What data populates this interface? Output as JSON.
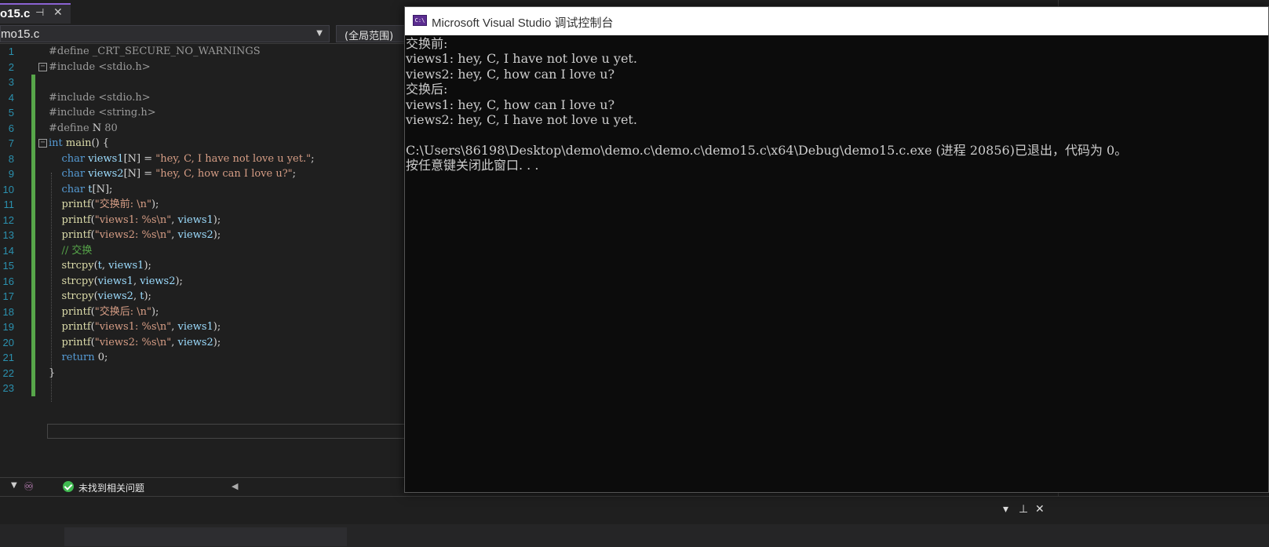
{
  "editor": {
    "tab": {
      "title": "o15.c",
      "pin_icon": "pin-icon",
      "close_icon": "close-icon"
    },
    "navbar": {
      "file": "mo15.c",
      "scope": "(全局范围)"
    },
    "lines": [
      {
        "num": "1",
        "segments": [
          {
            "t": "#define _CRT_SECURE_NO_WARNINGS",
            "c": "pp"
          }
        ]
      },
      {
        "num": "2",
        "segments": [
          {
            "t": "#include <stdio.h>",
            "c": "pp"
          }
        ]
      },
      {
        "num": "3",
        "segments": []
      },
      {
        "num": "4",
        "segments": [
          {
            "t": "#include <stdio.h>",
            "c": "pp"
          }
        ]
      },
      {
        "num": "5",
        "segments": [
          {
            "t": "#include <string.h>",
            "c": "pp"
          }
        ]
      },
      {
        "num": "6",
        "segments": [
          {
            "t": "#define ",
            "c": "pp"
          },
          {
            "t": "N",
            "c": "plain"
          },
          {
            "t": " 80",
            "c": "pp"
          }
        ]
      },
      {
        "num": "7",
        "segments": [
          {
            "t": "int",
            "c": "kw"
          },
          {
            "t": " ",
            "c": "plain"
          },
          {
            "t": "main",
            "c": "fn"
          },
          {
            "t": "() {",
            "c": "plain"
          }
        ]
      },
      {
        "num": "8",
        "segments": [
          {
            "t": "    ",
            "c": "plain"
          },
          {
            "t": "char",
            "c": "kw"
          },
          {
            "t": " ",
            "c": "plain"
          },
          {
            "t": "views1",
            "c": "id"
          },
          {
            "t": "[N] = ",
            "c": "plain"
          },
          {
            "t": "\"hey, C, I have not love u yet.\"",
            "c": "str"
          },
          {
            "t": ";",
            "c": "plain"
          }
        ]
      },
      {
        "num": "9",
        "segments": [
          {
            "t": "    ",
            "c": "plain"
          },
          {
            "t": "char",
            "c": "kw"
          },
          {
            "t": " ",
            "c": "plain"
          },
          {
            "t": "views2",
            "c": "id"
          },
          {
            "t": "[N] = ",
            "c": "plain"
          },
          {
            "t": "\"hey, C, how can I love u?\"",
            "c": "str"
          },
          {
            "t": ";",
            "c": "plain"
          }
        ]
      },
      {
        "num": "10",
        "segments": [
          {
            "t": "    ",
            "c": "plain"
          },
          {
            "t": "char",
            "c": "kw"
          },
          {
            "t": " ",
            "c": "plain"
          },
          {
            "t": "t",
            "c": "id"
          },
          {
            "t": "[N];",
            "c": "plain"
          }
        ]
      },
      {
        "num": "11",
        "segments": [
          {
            "t": "    ",
            "c": "plain"
          },
          {
            "t": "printf",
            "c": "fn"
          },
          {
            "t": "(",
            "c": "plain"
          },
          {
            "t": "\"交换前: \\n\"",
            "c": "str"
          },
          {
            "t": ");",
            "c": "plain"
          }
        ]
      },
      {
        "num": "12",
        "segments": [
          {
            "t": "    ",
            "c": "plain"
          },
          {
            "t": "printf",
            "c": "fn"
          },
          {
            "t": "(",
            "c": "plain"
          },
          {
            "t": "\"views1: %s\\n\"",
            "c": "str"
          },
          {
            "t": ", ",
            "c": "plain"
          },
          {
            "t": "views1",
            "c": "id"
          },
          {
            "t": ");",
            "c": "plain"
          }
        ]
      },
      {
        "num": "13",
        "segments": [
          {
            "t": "    ",
            "c": "plain"
          },
          {
            "t": "printf",
            "c": "fn"
          },
          {
            "t": "(",
            "c": "plain"
          },
          {
            "t": "\"views2: %s\\n\"",
            "c": "str"
          },
          {
            "t": ", ",
            "c": "plain"
          },
          {
            "t": "views2",
            "c": "id"
          },
          {
            "t": ");",
            "c": "plain"
          }
        ]
      },
      {
        "num": "14",
        "segments": [
          {
            "t": "    ",
            "c": "plain"
          },
          {
            "t": "// 交换",
            "c": "cmt"
          }
        ]
      },
      {
        "num": "15",
        "segments": [
          {
            "t": "    ",
            "c": "plain"
          },
          {
            "t": "strcpy",
            "c": "fn"
          },
          {
            "t": "(",
            "c": "plain"
          },
          {
            "t": "t",
            "c": "id"
          },
          {
            "t": ", ",
            "c": "plain"
          },
          {
            "t": "views1",
            "c": "id"
          },
          {
            "t": ");",
            "c": "plain"
          }
        ]
      },
      {
        "num": "16",
        "segments": [
          {
            "t": "    ",
            "c": "plain"
          },
          {
            "t": "strcpy",
            "c": "fn"
          },
          {
            "t": "(",
            "c": "plain"
          },
          {
            "t": "views1",
            "c": "id"
          },
          {
            "t": ", ",
            "c": "plain"
          },
          {
            "t": "views2",
            "c": "id"
          },
          {
            "t": ");",
            "c": "plain"
          }
        ]
      },
      {
        "num": "17",
        "segments": [
          {
            "t": "    ",
            "c": "plain"
          },
          {
            "t": "strcpy",
            "c": "fn"
          },
          {
            "t": "(",
            "c": "plain"
          },
          {
            "t": "views2",
            "c": "id"
          },
          {
            "t": ", ",
            "c": "plain"
          },
          {
            "t": "t",
            "c": "id"
          },
          {
            "t": ");",
            "c": "plain"
          }
        ]
      },
      {
        "num": "18",
        "segments": [
          {
            "t": "    ",
            "c": "plain"
          },
          {
            "t": "printf",
            "c": "fn"
          },
          {
            "t": "(",
            "c": "plain"
          },
          {
            "t": "\"交换后: \\n\"",
            "c": "str"
          },
          {
            "t": ");",
            "c": "plain"
          }
        ]
      },
      {
        "num": "19",
        "segments": [
          {
            "t": "    ",
            "c": "plain"
          },
          {
            "t": "printf",
            "c": "fn"
          },
          {
            "t": "(",
            "c": "plain"
          },
          {
            "t": "\"views1: %s\\n\"",
            "c": "str"
          },
          {
            "t": ", ",
            "c": "plain"
          },
          {
            "t": "views1",
            "c": "id"
          },
          {
            "t": ");",
            "c": "plain"
          }
        ]
      },
      {
        "num": "20",
        "segments": [
          {
            "t": "    ",
            "c": "plain"
          },
          {
            "t": "printf",
            "c": "fn"
          },
          {
            "t": "(",
            "c": "plain"
          },
          {
            "t": "\"views2: %s\\n\"",
            "c": "str"
          },
          {
            "t": ", ",
            "c": "plain"
          },
          {
            "t": "views2",
            "c": "id"
          },
          {
            "t": ");",
            "c": "plain"
          }
        ]
      },
      {
        "num": "21",
        "segments": [
          {
            "t": "    ",
            "c": "plain"
          },
          {
            "t": "return",
            "c": "kw"
          },
          {
            "t": " 0;",
            "c": "plain"
          }
        ]
      },
      {
        "num": "22",
        "segments": [
          {
            "t": "}",
            "c": "plain"
          }
        ]
      },
      {
        "num": "23",
        "segments": []
      }
    ]
  },
  "status": {
    "issues": "未找到相关问题",
    "ok_icon": "check-circle-icon",
    "copilot_icon": "copilot-icon"
  },
  "bottom_panel": {
    "dropdown_icon": "chevron-down-icon",
    "pin_icon": "pin-icon",
    "close_icon": "close-icon"
  },
  "console": {
    "title": "Microsoft Visual Studio 调试控制台",
    "icon": "console-app-icon",
    "lines": [
      "交换前:",
      "views1: hey, C, I have not love u yet.",
      "views2: hey, C, how can I love u?",
      "交换后:",
      "views1: hey, C, how can I love u?",
      "views2: hey, C, I have not love u yet.",
      "",
      "C:\\Users\\86198\\Desktop\\demo\\demo.c\\demo.c\\demo15.c\\x64\\Debug\\demo15.c.exe (进程 20856)已退出，代码为 0。",
      "按任意键关闭此窗口. . ."
    ]
  },
  "colors": {
    "editor_bg": "#1f1f1f",
    "line_number": "#2b91af",
    "change_marker": "#57a64a",
    "keyword": "#569cd6",
    "string": "#d69d85",
    "function": "#dcdcaa",
    "identifier": "#9cdcfe",
    "console_bg": "#0c0c0c",
    "console_text": "#cccccc"
  }
}
